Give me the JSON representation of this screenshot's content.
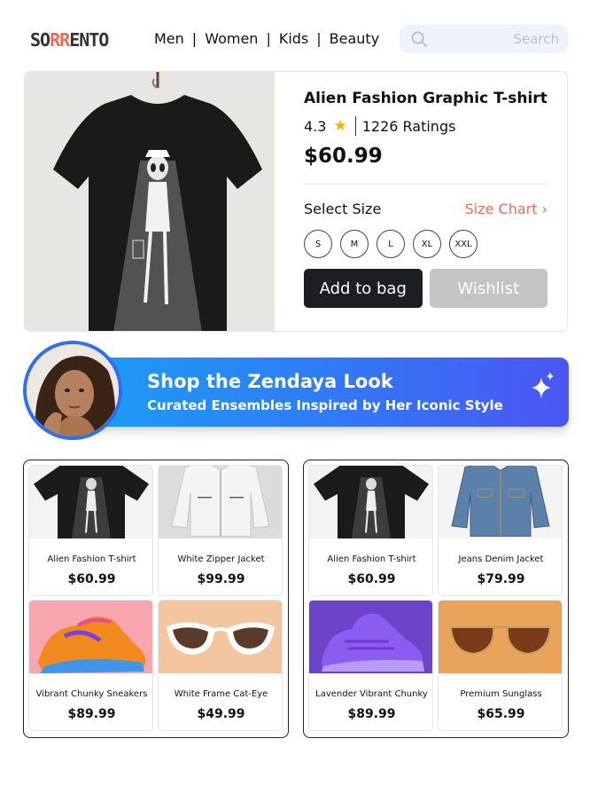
{
  "header": {
    "logo": {
      "part1": "SO",
      "part2": "RR",
      "part3": "ENTO"
    },
    "nav": [
      {
        "label": "Men"
      },
      {
        "label": "Women"
      },
      {
        "label": "Kids"
      },
      {
        "label": "Beauty"
      }
    ],
    "separator": "|",
    "search": {
      "placeholder": "Search",
      "icon": "search-icon"
    }
  },
  "product": {
    "title": "Alien Fashion Graphic T-shirt",
    "rating": "4.3",
    "rating_icon": "star-icon",
    "ratings_count": "1226 Ratings",
    "price": "$60.99",
    "select_size_label": "Select Size",
    "size_chart_label": "Size Chart",
    "sizes": [
      "S",
      "M",
      "L",
      "XL",
      "XXL"
    ],
    "add_to_bag_label": "Add to bag",
    "wishlist_label": "Wishlist"
  },
  "banner": {
    "title": "Shop the Zendaya Look",
    "subtitle": "Curated Ensembles Inspired by Her Iconic Style",
    "icon": "sparkle-icon"
  },
  "looks": [
    {
      "items": [
        {
          "name": "Alien Fashion T-shirt",
          "price": "$60.99"
        },
        {
          "name": "White Zipper Jacket",
          "price": "$99.99"
        },
        {
          "name": "Vibrant Chunky Sneakers",
          "price": "$89.99"
        },
        {
          "name": "White Frame Cat-Eye",
          "price": "$49.99"
        }
      ]
    },
    {
      "items": [
        {
          "name": "Alien Fashion T-shirt",
          "price": "$60.99"
        },
        {
          "name": "Jeans Denim Jacket",
          "price": "$79.99"
        },
        {
          "name": "Lavender Vibrant Chunky",
          "price": "$89.99"
        },
        {
          "name": "Premium Sunglass",
          "price": "$65.99"
        }
      ]
    }
  ],
  "colors": {
    "accent": "#ef6a55",
    "banner_start": "#1aa0f5",
    "banner_end": "#4a56f2",
    "button_dark": "#1c1f22",
    "button_disabled": "#c4c4c4"
  }
}
